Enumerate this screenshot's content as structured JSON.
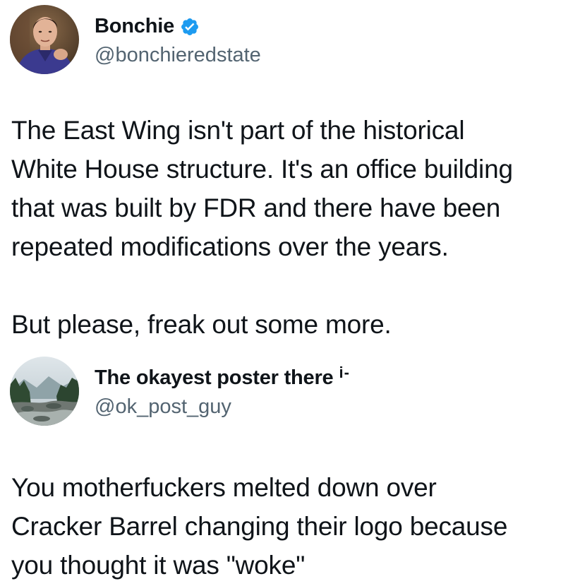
{
  "tweets": [
    {
      "author": {
        "display_name": "Bonchie",
        "handle": "@bonchieredstate",
        "verified": true,
        "verified_color": "#1d9bf0",
        "avatar": "man-in-purple-shirt-portrait"
      },
      "paragraphs": [
        "The East Wing isn't part of the historical\nWhite House structure. It's an office building\nthat was built by FDR and there have been\nrepeated modifications over the years.",
        "But please, freak out some more."
      ]
    },
    {
      "author": {
        "display_name": "The okayest poster there",
        "display_name_truncation": "i-",
        "handle": "@ok_post_guy",
        "verified": false,
        "avatar": "mountain-river-landscape"
      },
      "paragraphs": [
        "You motherfuckers melted down over\nCracker Barrel changing their logo because\nyou thought it was \"woke\""
      ]
    }
  ],
  "colors": {
    "text_primary": "#0f1419",
    "text_secondary": "#536471",
    "background": "#ffffff"
  }
}
